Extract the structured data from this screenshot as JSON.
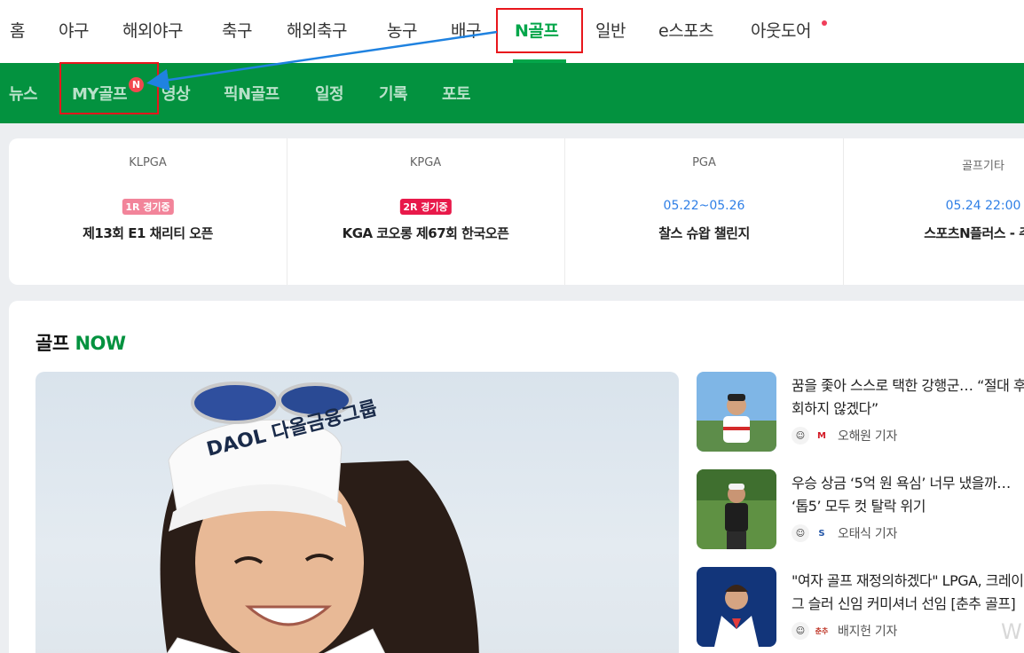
{
  "top_nav": {
    "items": [
      {
        "label": "홈"
      },
      {
        "label": "야구"
      },
      {
        "label": "해외야구"
      },
      {
        "label": "축구"
      },
      {
        "label": "해외축구"
      },
      {
        "label": "농구"
      },
      {
        "label": "배구"
      },
      {
        "label": "N골프",
        "active": true
      },
      {
        "label": "일반"
      },
      {
        "label": "e스포츠"
      },
      {
        "label": "아웃도어",
        "new_dot": true
      }
    ]
  },
  "sub_nav": {
    "items": [
      {
        "label": "뉴스"
      },
      {
        "label": "MY골프",
        "badge": "N"
      },
      {
        "label": "영상"
      },
      {
        "label": "픽N골프"
      },
      {
        "label": "일정"
      },
      {
        "label": "기록"
      },
      {
        "label": "포토"
      }
    ]
  },
  "schedule": [
    {
      "league": "KLPGA",
      "status": "1R 경기중",
      "status_color": "#f2849a",
      "title": "제13회 E1 채리티 오픈"
    },
    {
      "league": "KPGA",
      "status": "2R 경기중",
      "status_color": "#e8194a",
      "title": "KGA 코오롱 제67회 한국오픈"
    },
    {
      "league": "PGA",
      "date": "05.22~05.26",
      "title": "찰스 슈왑 챌린지"
    },
    {
      "league": "골프기타",
      "date": "05.24 22:00",
      "title": "스포츠N플러스 - 주말"
    }
  ],
  "golf_now": {
    "title_prefix": "골프",
    "title_accent": "NOW",
    "hero_visor_text": "DAOL 다올금융그룹",
    "news": [
      {
        "headline": "꿈을 좇아 스스로 택한 강행군… “절대 후회하지 않겠다”",
        "reporter": "오해원 기자",
        "press_icon": "M"
      },
      {
        "headline": "우승 상금 ‘5억 원 욕심’ 너무 냈을까… ‘톱5’ 모두 컷 탈락 위기",
        "reporter": "오태식 기자",
        "press_icon": "S"
      },
      {
        "headline": "\"여자 골프 재정의하겠다\" LPGA, 크레이그 슬러 신임 커미셔너 선임 [춘추 골프]",
        "reporter": "배지헌 기자",
        "press_icon": "춘추"
      }
    ]
  },
  "watermark": "W",
  "colors": {
    "brand_green": "#03923f",
    "active_green": "#03a64a",
    "highlight_red": "#e8161c",
    "annotation_arrow": "#1f82e0"
  }
}
